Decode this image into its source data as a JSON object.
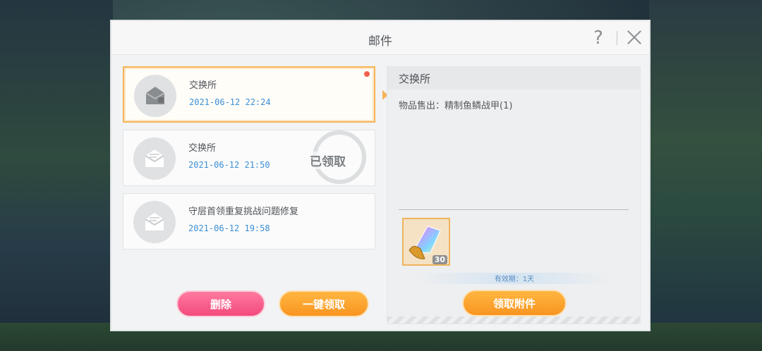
{
  "dialog": {
    "title": "邮件",
    "help_label": "?"
  },
  "mails": [
    {
      "title": "交换所",
      "date": "2021-06-12  22:24",
      "state": "unread-selected"
    },
    {
      "title": "交换所",
      "date": "2021-06-12  21:50",
      "state": "claimed",
      "claimed_label": "已领取"
    },
    {
      "title": "守层首领重复挑战问题修复",
      "date": "2021-06-12  19:58",
      "state": "read"
    }
  ],
  "actions": {
    "delete_label": "删除",
    "claim_all_label": "一键领取"
  },
  "detail": {
    "title": "交换所",
    "body": "物品售出：精制鱼鳞战甲(1)",
    "attachment": {
      "icon": "crystal-icon",
      "count": "30"
    },
    "expire_label": "有效期：1天",
    "claim_label": "领取附件"
  },
  "colors": {
    "accent_orange": "#f89520",
    "delete_pink": "#f24a7c",
    "date_blue": "#3b8fd6",
    "unread_dot": "#f0614d"
  }
}
